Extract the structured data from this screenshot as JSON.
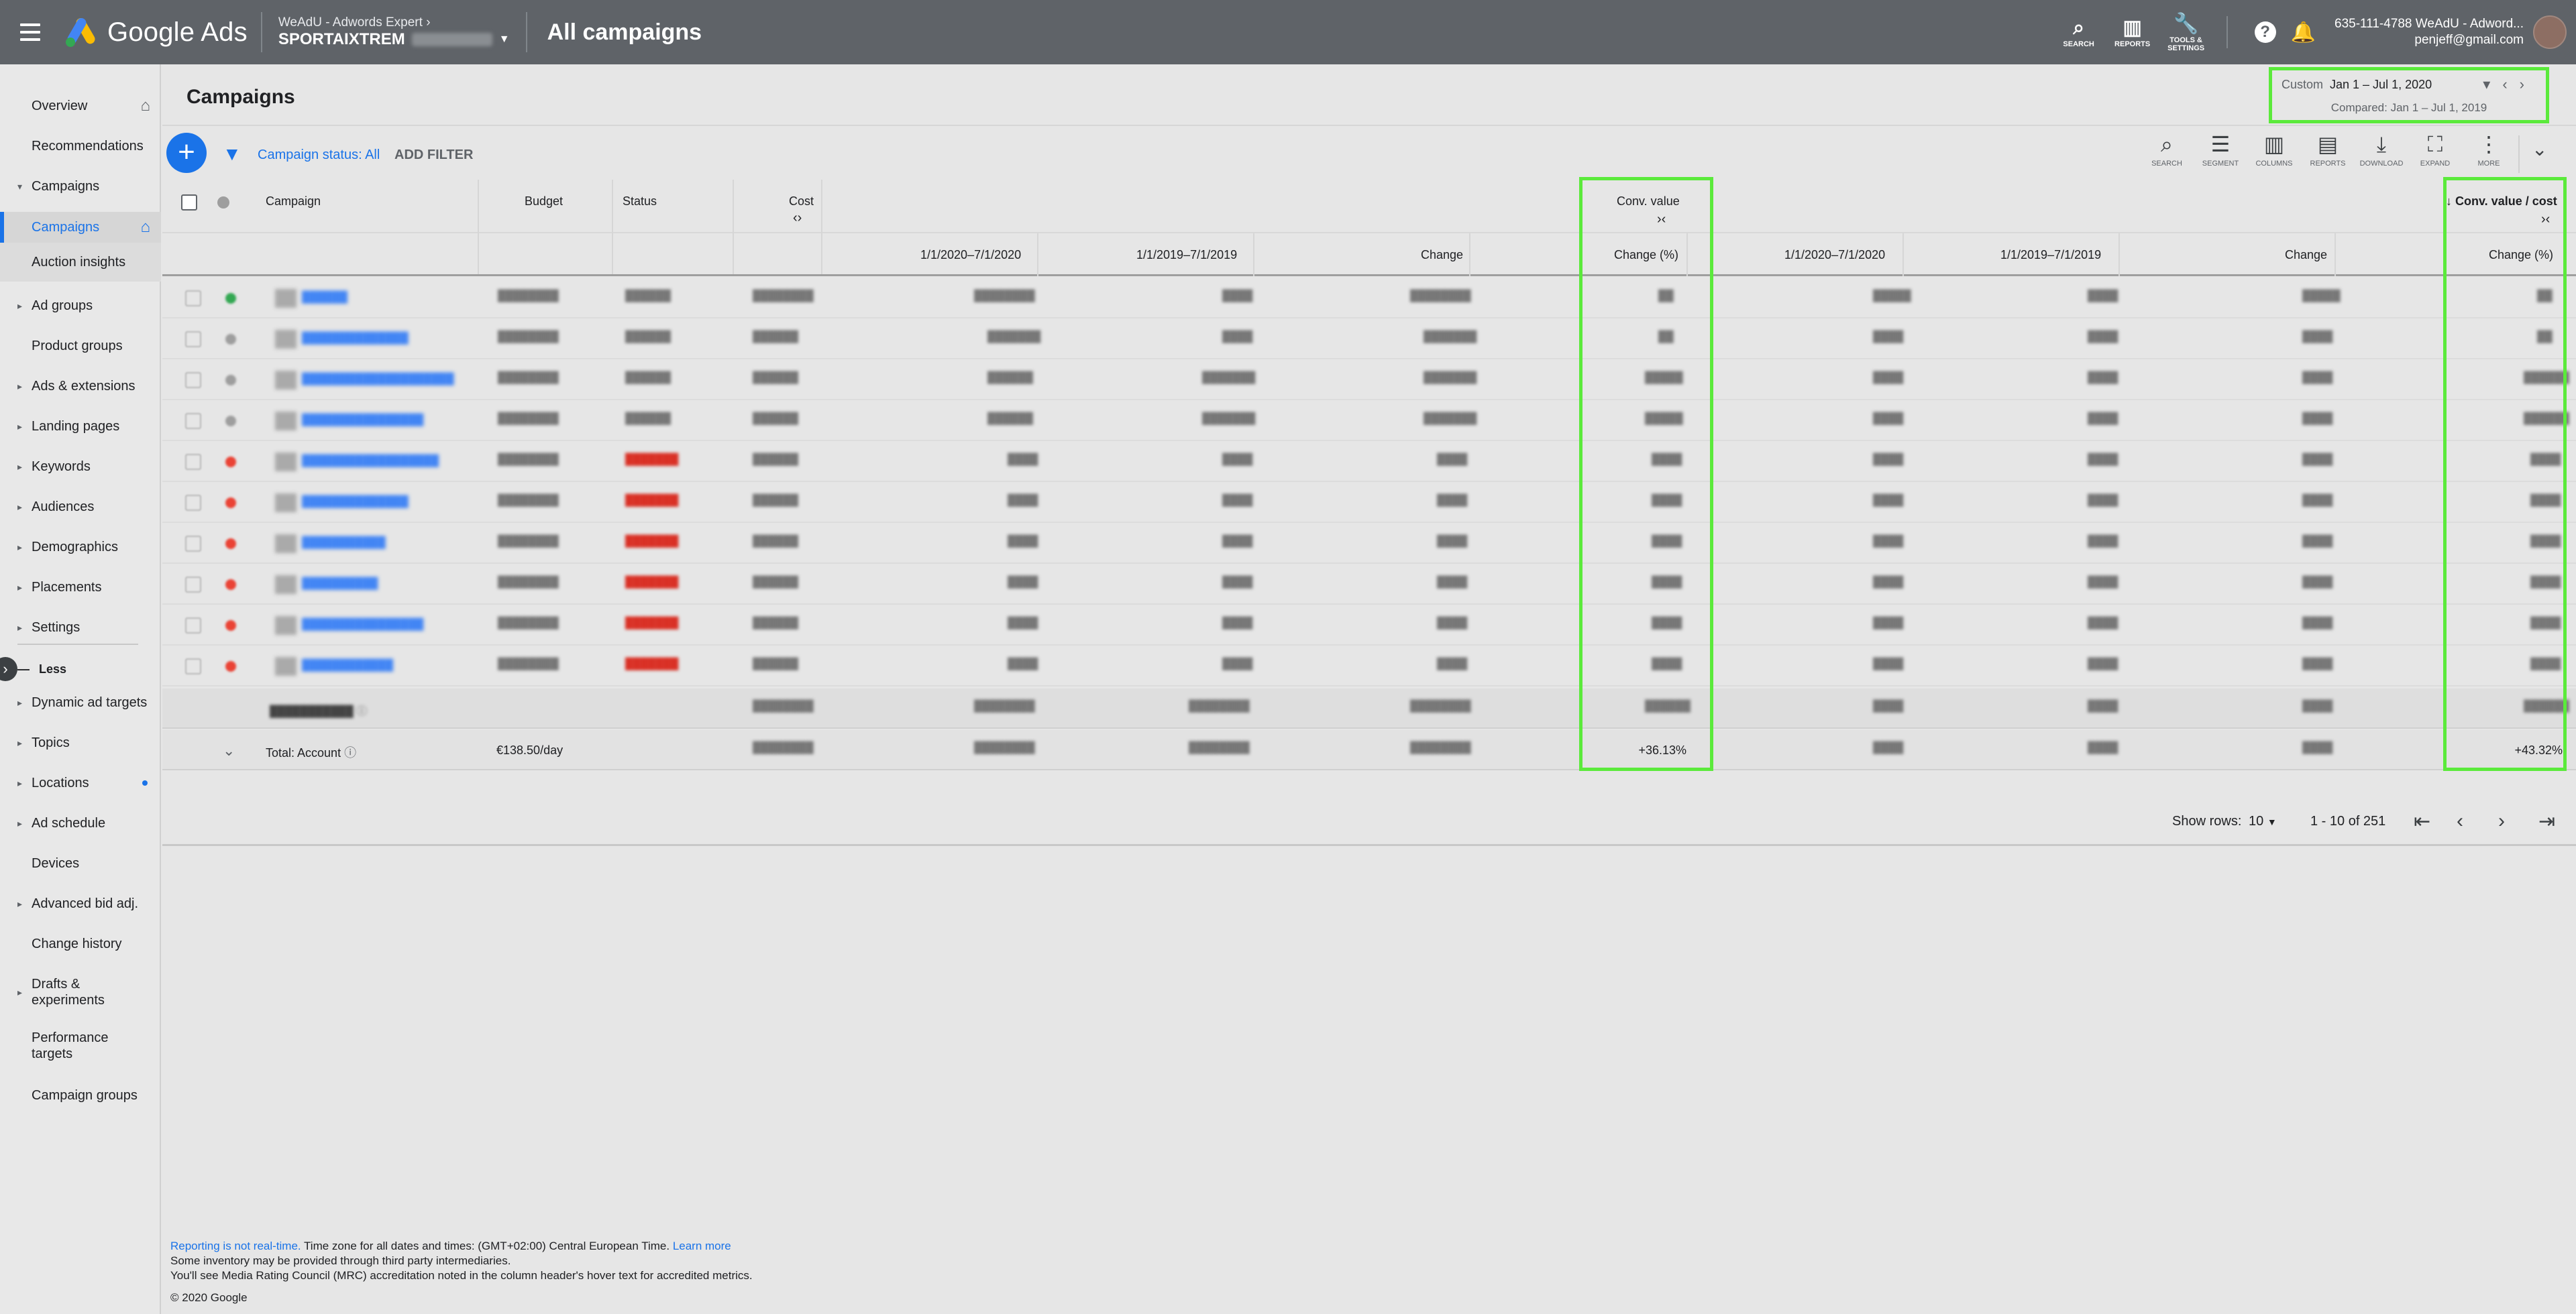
{
  "topbar": {
    "brand": "Google Ads",
    "account_parent": "WeAdU - Adwords Expert",
    "account_name": "SPORTAIXTREM",
    "page_heading": "All campaigns",
    "tools": [
      {
        "label": "SEARCH",
        "icon": "search-icon"
      },
      {
        "label": "REPORTS",
        "icon": "reports-icon"
      },
      {
        "label": "TOOLS & SETTINGS",
        "icon": "wrench-icon"
      }
    ],
    "user_line1": "635-111-4788 WeAdU - Adword...",
    "user_line2": "penjeff@gmail.com"
  },
  "sidebar": {
    "items": [
      {
        "label": "Overview"
      },
      {
        "label": "Recommendations"
      },
      {
        "label": "Campaigns"
      },
      {
        "label": "Campaigns"
      },
      {
        "label": "Auction insights"
      },
      {
        "label": "Ad groups"
      },
      {
        "label": "Product groups"
      },
      {
        "label": "Ads & extensions"
      },
      {
        "label": "Landing pages"
      },
      {
        "label": "Keywords"
      },
      {
        "label": "Audiences"
      },
      {
        "label": "Demographics"
      },
      {
        "label": "Placements"
      },
      {
        "label": "Settings"
      },
      {
        "label": "Less"
      },
      {
        "label": "Dynamic ad targets"
      },
      {
        "label": "Topics"
      },
      {
        "label": "Locations"
      },
      {
        "label": "Ad schedule"
      },
      {
        "label": "Devices"
      },
      {
        "label": "Advanced bid adj."
      },
      {
        "label": "Change history"
      },
      {
        "label": "Drafts & experiments"
      },
      {
        "label": "Performance targets"
      },
      {
        "label": "Campaign groups"
      }
    ]
  },
  "main": {
    "title": "Campaigns",
    "date": {
      "custom": "Custom",
      "range": "Jan 1 – Jul 1, 2020",
      "compared": "Compared: Jan 1 – Jul 1, 2019"
    },
    "filter": {
      "status": "Campaign status: All",
      "add": "ADD FILTER"
    },
    "toolbar": [
      {
        "label": "SEARCH",
        "icon": "search-icon"
      },
      {
        "label": "SEGMENT",
        "icon": "segment-icon"
      },
      {
        "label": "COLUMNS",
        "icon": "columns-icon"
      },
      {
        "label": "REPORTS",
        "icon": "reports-icon"
      },
      {
        "label": "DOWNLOAD",
        "icon": "download-icon"
      },
      {
        "label": "EXPAND",
        "icon": "expand-icon"
      },
      {
        "label": "MORE",
        "icon": "more-icon"
      }
    ],
    "table": {
      "headers": {
        "campaign": "Campaign",
        "budget": "Budget",
        "status": "Status",
        "cost": "Cost",
        "conv_value": "Conv. value",
        "conv_value_cost": "Conv. value / cost"
      },
      "subheaders": {
        "p1": "1/1/2020–7/1/2020",
        "p2": "1/1/2019–7/1/2019",
        "change": "Change",
        "change_pct": "Change (%)"
      },
      "total_account": {
        "label": "Total: Account",
        "budget": "€138.50/day",
        "conv_change_pct": "+36.13%",
        "cvc_change_pct": "+43.32%"
      }
    },
    "pager": {
      "show_rows_label": "Show rows:",
      "rows": "10",
      "range": "1 - 10 of 251"
    }
  },
  "footer": {
    "link1": "Reporting is not real-time.",
    "text1": " Time zone for all dates and times: (GMT+02:00) Central European Time. ",
    "link2": "Learn more",
    "text2": "Some inventory may be provided through third party intermediaries.",
    "text3": "You'll see Media Rating Council (MRC) accreditation noted in the column header's hover text for accredited metrics.",
    "copyright": "© 2020 Google"
  },
  "colors": {
    "accent": "#1a73e8",
    "highlight": "#5bea3b",
    "topbar": "#5f6368"
  }
}
